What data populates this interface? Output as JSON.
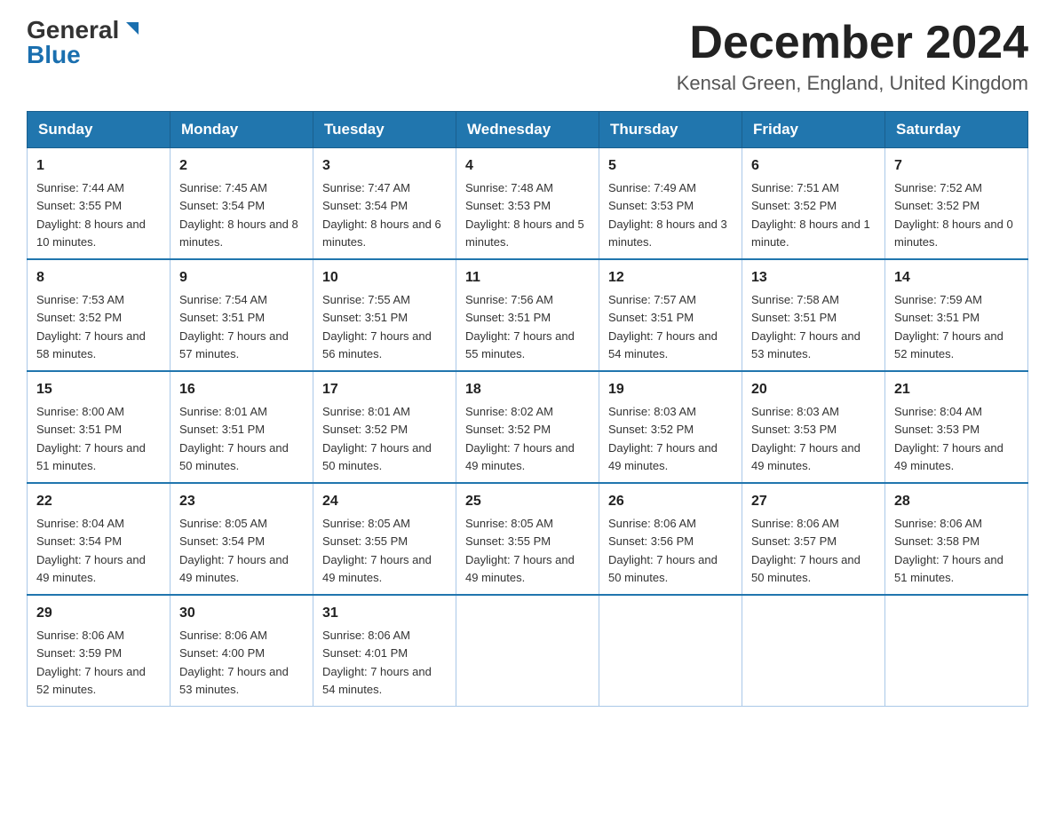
{
  "header": {
    "logo_general": "General",
    "logo_blue": "Blue",
    "month_title": "December 2024",
    "location": "Kensal Green, England, United Kingdom"
  },
  "days_of_week": [
    "Sunday",
    "Monday",
    "Tuesday",
    "Wednesday",
    "Thursday",
    "Friday",
    "Saturday"
  ],
  "weeks": [
    [
      {
        "day": "1",
        "sunrise": "7:44 AM",
        "sunset": "3:55 PM",
        "daylight": "8 hours and 10 minutes."
      },
      {
        "day": "2",
        "sunrise": "7:45 AM",
        "sunset": "3:54 PM",
        "daylight": "8 hours and 8 minutes."
      },
      {
        "day": "3",
        "sunrise": "7:47 AM",
        "sunset": "3:54 PM",
        "daylight": "8 hours and 6 minutes."
      },
      {
        "day": "4",
        "sunrise": "7:48 AM",
        "sunset": "3:53 PM",
        "daylight": "8 hours and 5 minutes."
      },
      {
        "day": "5",
        "sunrise": "7:49 AM",
        "sunset": "3:53 PM",
        "daylight": "8 hours and 3 minutes."
      },
      {
        "day": "6",
        "sunrise": "7:51 AM",
        "sunset": "3:52 PM",
        "daylight": "8 hours and 1 minute."
      },
      {
        "day": "7",
        "sunrise": "7:52 AM",
        "sunset": "3:52 PM",
        "daylight": "8 hours and 0 minutes."
      }
    ],
    [
      {
        "day": "8",
        "sunrise": "7:53 AM",
        "sunset": "3:52 PM",
        "daylight": "7 hours and 58 minutes."
      },
      {
        "day": "9",
        "sunrise": "7:54 AM",
        "sunset": "3:51 PM",
        "daylight": "7 hours and 57 minutes."
      },
      {
        "day": "10",
        "sunrise": "7:55 AM",
        "sunset": "3:51 PM",
        "daylight": "7 hours and 56 minutes."
      },
      {
        "day": "11",
        "sunrise": "7:56 AM",
        "sunset": "3:51 PM",
        "daylight": "7 hours and 55 minutes."
      },
      {
        "day": "12",
        "sunrise": "7:57 AM",
        "sunset": "3:51 PM",
        "daylight": "7 hours and 54 minutes."
      },
      {
        "day": "13",
        "sunrise": "7:58 AM",
        "sunset": "3:51 PM",
        "daylight": "7 hours and 53 minutes."
      },
      {
        "day": "14",
        "sunrise": "7:59 AM",
        "sunset": "3:51 PM",
        "daylight": "7 hours and 52 minutes."
      }
    ],
    [
      {
        "day": "15",
        "sunrise": "8:00 AM",
        "sunset": "3:51 PM",
        "daylight": "7 hours and 51 minutes."
      },
      {
        "day": "16",
        "sunrise": "8:01 AM",
        "sunset": "3:51 PM",
        "daylight": "7 hours and 50 minutes."
      },
      {
        "day": "17",
        "sunrise": "8:01 AM",
        "sunset": "3:52 PM",
        "daylight": "7 hours and 50 minutes."
      },
      {
        "day": "18",
        "sunrise": "8:02 AM",
        "sunset": "3:52 PM",
        "daylight": "7 hours and 49 minutes."
      },
      {
        "day": "19",
        "sunrise": "8:03 AM",
        "sunset": "3:52 PM",
        "daylight": "7 hours and 49 minutes."
      },
      {
        "day": "20",
        "sunrise": "8:03 AM",
        "sunset": "3:53 PM",
        "daylight": "7 hours and 49 minutes."
      },
      {
        "day": "21",
        "sunrise": "8:04 AM",
        "sunset": "3:53 PM",
        "daylight": "7 hours and 49 minutes."
      }
    ],
    [
      {
        "day": "22",
        "sunrise": "8:04 AM",
        "sunset": "3:54 PM",
        "daylight": "7 hours and 49 minutes."
      },
      {
        "day": "23",
        "sunrise": "8:05 AM",
        "sunset": "3:54 PM",
        "daylight": "7 hours and 49 minutes."
      },
      {
        "day": "24",
        "sunrise": "8:05 AM",
        "sunset": "3:55 PM",
        "daylight": "7 hours and 49 minutes."
      },
      {
        "day": "25",
        "sunrise": "8:05 AM",
        "sunset": "3:55 PM",
        "daylight": "7 hours and 49 minutes."
      },
      {
        "day": "26",
        "sunrise": "8:06 AM",
        "sunset": "3:56 PM",
        "daylight": "7 hours and 50 minutes."
      },
      {
        "day": "27",
        "sunrise": "8:06 AM",
        "sunset": "3:57 PM",
        "daylight": "7 hours and 50 minutes."
      },
      {
        "day": "28",
        "sunrise": "8:06 AM",
        "sunset": "3:58 PM",
        "daylight": "7 hours and 51 minutes."
      }
    ],
    [
      {
        "day": "29",
        "sunrise": "8:06 AM",
        "sunset": "3:59 PM",
        "daylight": "7 hours and 52 minutes."
      },
      {
        "day": "30",
        "sunrise": "8:06 AM",
        "sunset": "4:00 PM",
        "daylight": "7 hours and 53 minutes."
      },
      {
        "day": "31",
        "sunrise": "8:06 AM",
        "sunset": "4:01 PM",
        "daylight": "7 hours and 54 minutes."
      },
      null,
      null,
      null,
      null
    ]
  ]
}
